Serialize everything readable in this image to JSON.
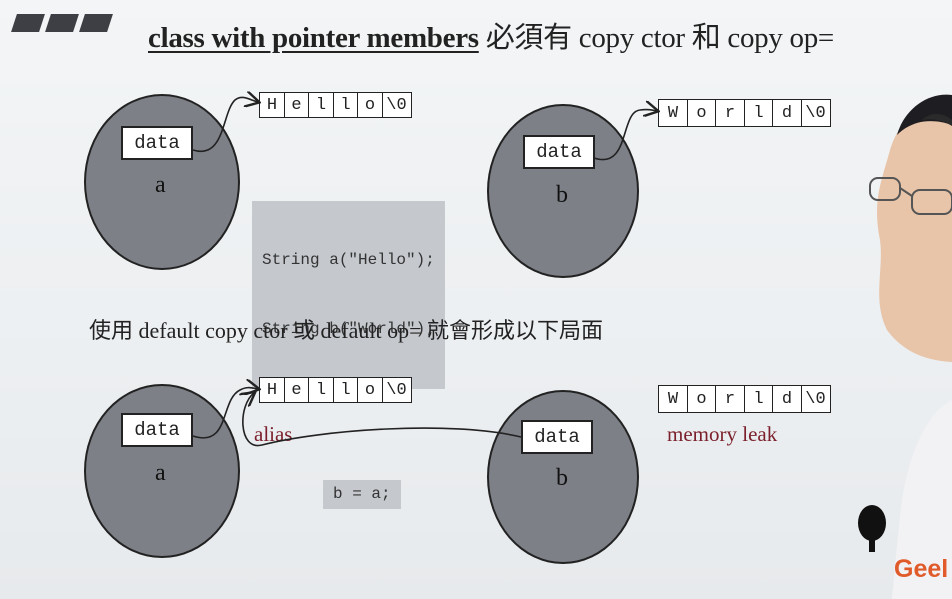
{
  "title": {
    "main": "class with pointer members",
    "rest": " 必須有 copy ctor 和 copy op="
  },
  "top": {
    "left": {
      "field": "data",
      "var": "a",
      "chars": [
        "H",
        "e",
        "l",
        "l",
        "o",
        "\\0"
      ]
    },
    "right": {
      "field": "data",
      "var": "b",
      "chars": [
        "W",
        "o",
        "r",
        "l",
        "d",
        "\\0"
      ]
    },
    "code_lines": [
      "String a(\"Hello\");",
      "String b(\"World\");"
    ]
  },
  "subtitle": "使用 default copy ctor 或 default op= 就會形成以下局面",
  "bottom": {
    "left": {
      "field": "data",
      "var": "a",
      "chars": [
        "H",
        "e",
        "l",
        "l",
        "o",
        "\\0"
      ]
    },
    "right": {
      "field": "data",
      "var": "b",
      "chars": [
        "W",
        "o",
        "r",
        "l",
        "d",
        "\\0"
      ]
    },
    "alias_label": "alias",
    "leak_label": "memory leak",
    "code": "b = a;"
  },
  "brand": "Geel",
  "colors": {
    "ellipse": "#7d8087",
    "note": "#7a1f2b",
    "code_bg": "#c5c9ce",
    "brand": "#e05a2a"
  }
}
